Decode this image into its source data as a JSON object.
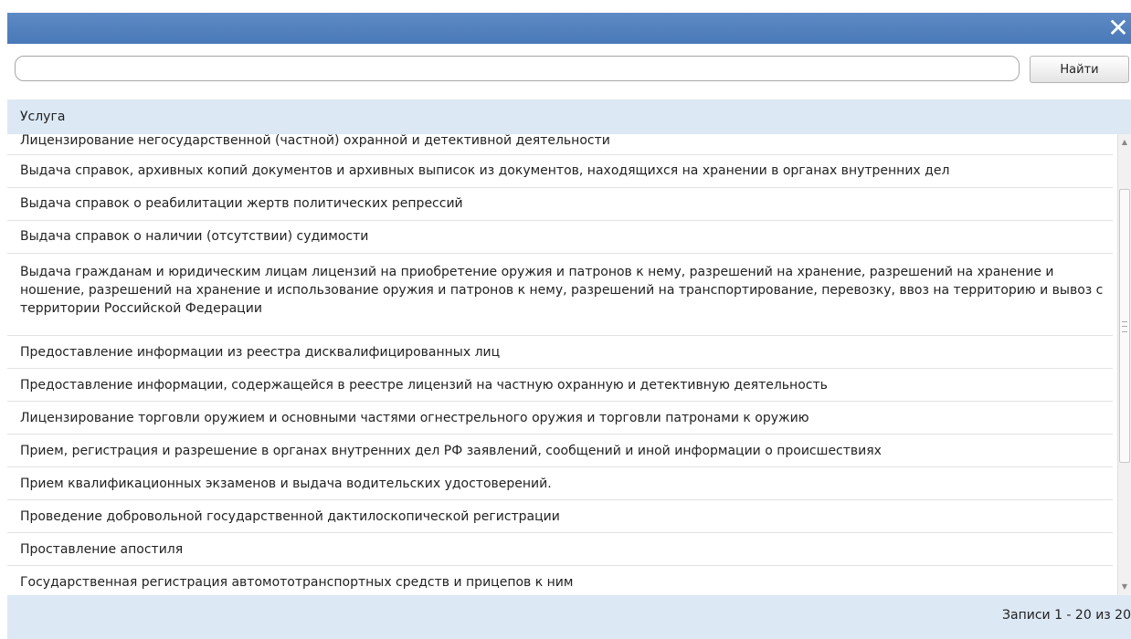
{
  "dialog": {
    "close_glyph": "✕"
  },
  "search": {
    "value": "",
    "button_label": "Найти"
  },
  "grid": {
    "column_header": "Услуга",
    "rows": [
      "Лицензирование негосударственной (частной) охранной и детективной деятельности",
      "Выдача справок, архивных копий документов и архивных выписок из документов, находящихся на хранении в органах внутренних дел",
      "Выдача справок о реабилитации жертв политических репрессий",
      "Выдача справок о наличии (отсутствии) судимости",
      "Выдача гражданам и юридическим лицам лицензий на приобретение оружия и патронов к нему, разрешений на хранение, разрешений на хранение и ношение, разрешений на хранение и использование оружия и патронов к нему, разрешений на транспортирование, перевозку, ввоз на территорию и вывоз с территории Российской Федерации",
      "Предоставление информации из реестра дисквалифицированных лиц",
      "Предоставление информации, содержащейся в реестре лицензий на частную охранную и детективную деятельность",
      "Лицензирование торговли оружием и основными частями огнестрельного оружия и торговли патронами к оружию",
      "Прием, регистрация и разрешение в органах внутренних дел РФ заявлений, сообщений и иной информации о происшествиях",
      "Прием квалификационных экзаменов и выдача водительских удостоверений.",
      "Проведение добровольной государственной дактилоскопической регистрации",
      "Проставление апостиля",
      "Государственная регистрация автомототранспортных средств и прицепов к ним"
    ]
  },
  "pager": {
    "status": "Записи 1 - 20 из 20"
  },
  "colors": {
    "titlebar": "#4a79b8",
    "header_bg": "#dce8f4",
    "row_border": "#e2e2e2"
  }
}
